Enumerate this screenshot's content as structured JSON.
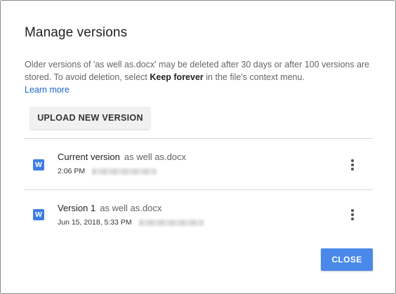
{
  "dialog": {
    "title": "Manage versions",
    "description_prefix": "Older versions of 'as well as.docx' may be deleted after 30 days or after 100 versions are stored. To avoid deletion, select ",
    "description_bold": "Keep forever",
    "description_suffix": " in the file's context menu.",
    "learn_more_label": "Learn more",
    "upload_button_label": "UPLOAD NEW VERSION",
    "close_button_label": "CLOSE"
  },
  "versions": [
    {
      "icon": "word-doc-icon",
      "icon_letter": "W",
      "label": "Current version",
      "file_name": "as well as.docx",
      "timestamp": "2:06 PM"
    },
    {
      "icon": "word-doc-icon",
      "icon_letter": "W",
      "label": "Version 1",
      "file_name": "as well as.docx",
      "timestamp": "Jun 15, 2018, 5:33 PM"
    }
  ],
  "colors": {
    "accent": "#4a89ea",
    "link": "#1a64c8",
    "word_icon": "#3f7de3"
  }
}
